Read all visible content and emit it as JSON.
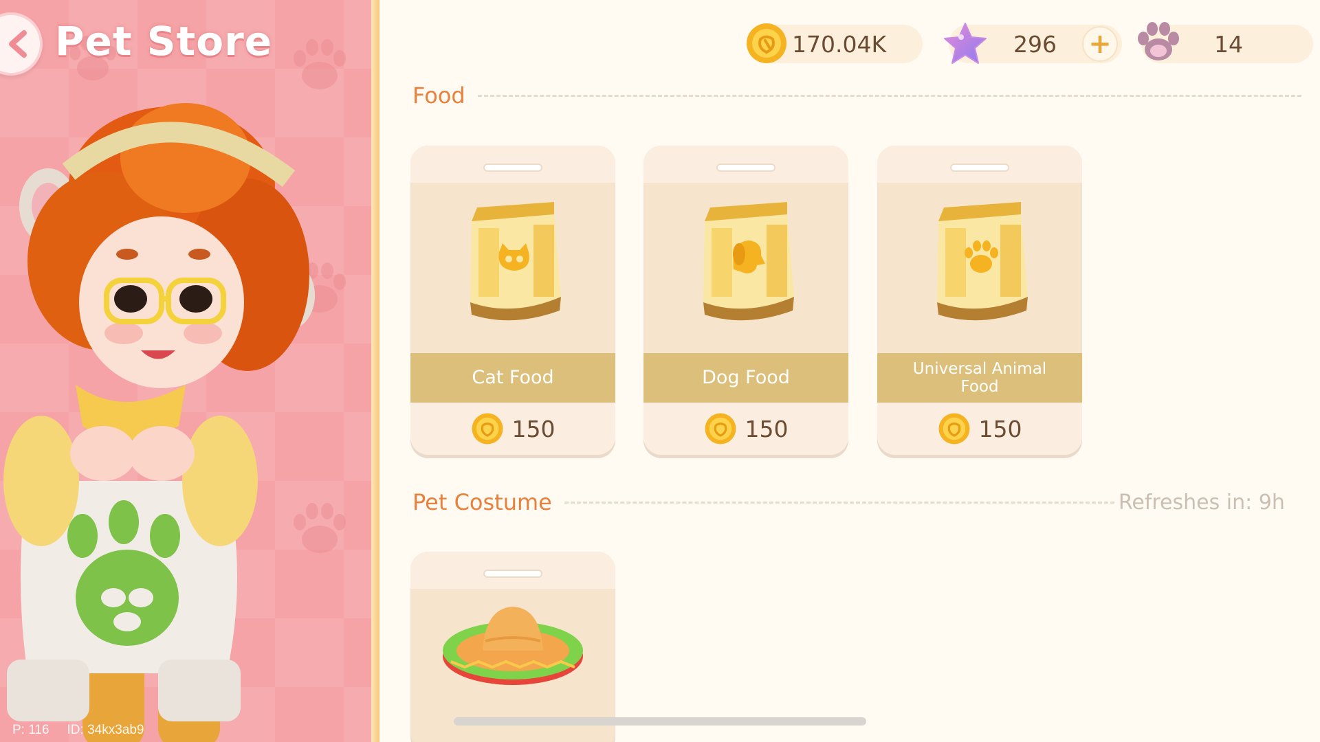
{
  "header": {
    "title": "Pet Store"
  },
  "player": {
    "level_label": "P: 116",
    "id_label": "ID: 34kx3ab9"
  },
  "currencies": {
    "coins": "170.04K",
    "stars": "296",
    "paws": "14"
  },
  "sections": {
    "food": {
      "title": "Food",
      "items": [
        {
          "name": "Cat Food",
          "price": "150"
        },
        {
          "name": "Dog Food",
          "price": "150"
        },
        {
          "name": "Universal Animal Food",
          "price": "150"
        }
      ]
    },
    "costume": {
      "title": "Pet Costume",
      "refresh": "Refreshes in: 9h"
    }
  },
  "colors": {
    "accent": "#e8813d",
    "panel_pink": "#f5a3a6",
    "card_band": "#dbbf7a",
    "coin_gold": "#f5b321",
    "star_purple": "#b07ae8"
  },
  "icons": {
    "back": "chevron-left-icon",
    "coin": "coin-icon",
    "star": "star-icon",
    "add": "plus-icon",
    "paw": "paw-icon"
  }
}
